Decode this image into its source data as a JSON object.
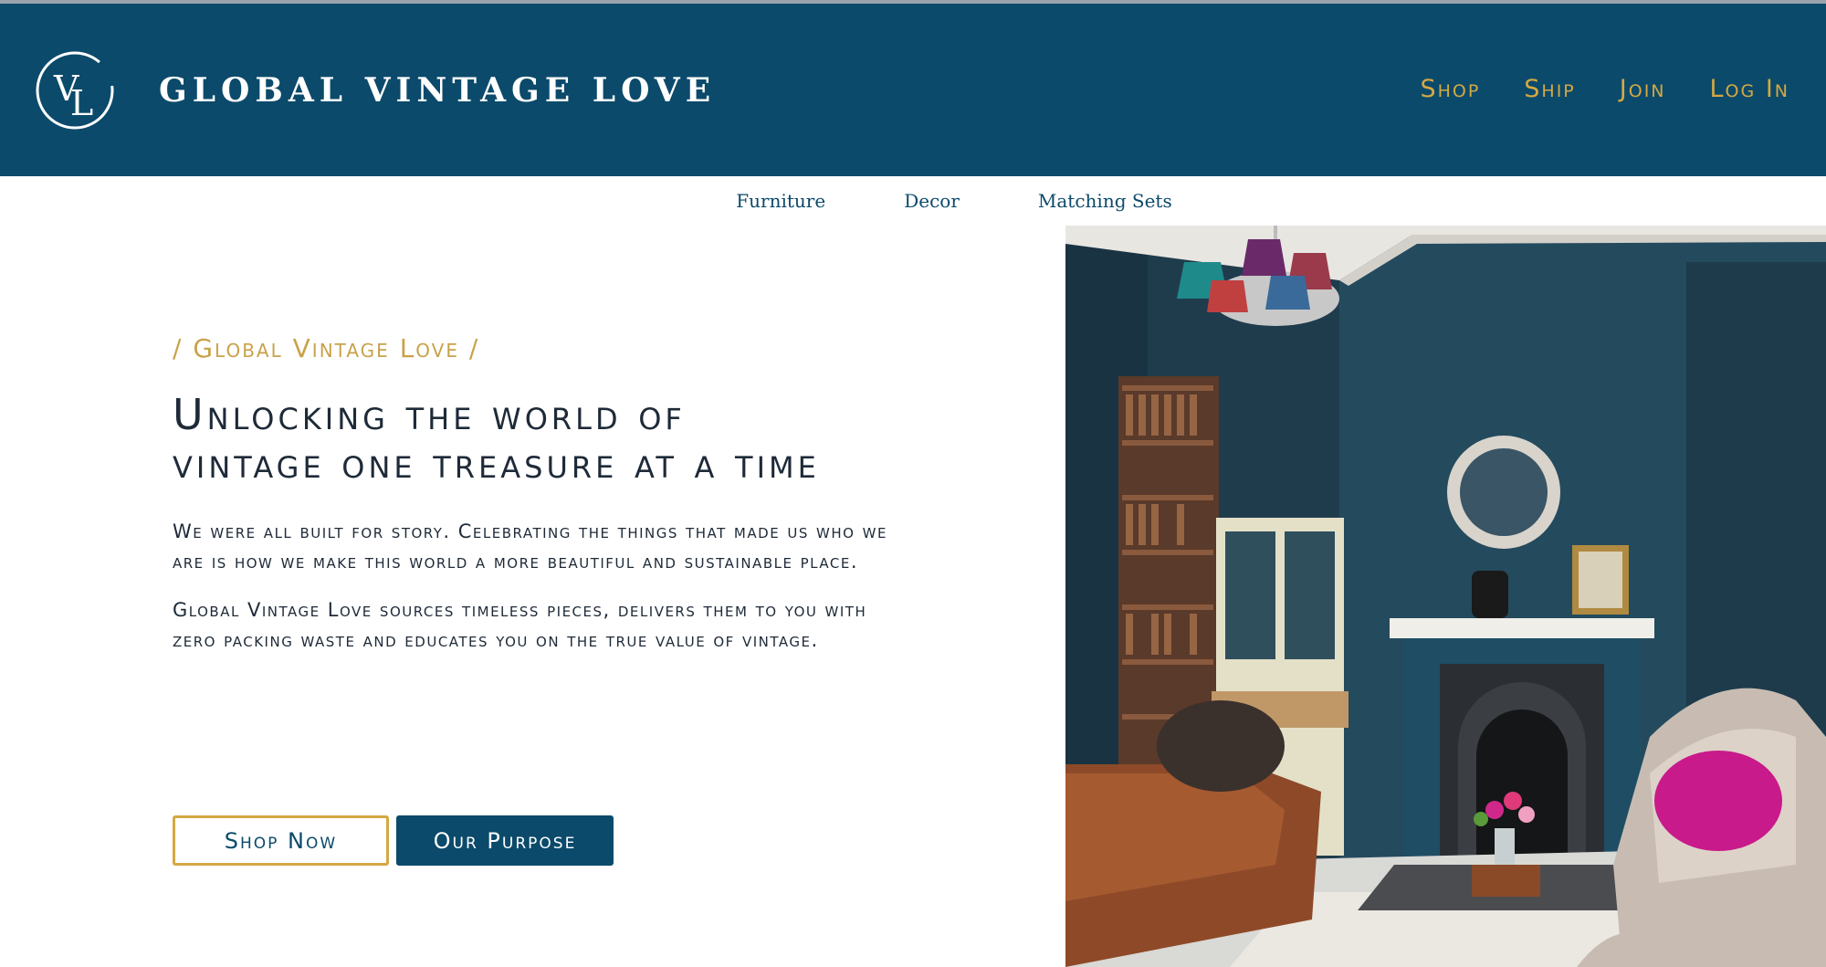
{
  "brand": {
    "logo_monogram": "VL",
    "name": "GLOBAL VINTAGE LOVE"
  },
  "topnav": {
    "items": [
      "Shop",
      "Ship",
      "Join",
      "Log In"
    ]
  },
  "subnav": {
    "items": [
      "Furniture",
      "Decor",
      "Matching Sets"
    ]
  },
  "hero": {
    "eyebrow": "/ Global Vintage Love /",
    "headline": "Unlocking the world of vintage one treasure at a time",
    "paragraph_1": "We were all built for story. Celebrating the things that made us who we are is how we make this world a more beautiful and sustainable place.",
    "paragraph_2": "Global Vintage Love sources timeless pieces, delivers them to you with zero packing waste and educates you on the true value of vintage.",
    "button_primary": "Shop Now",
    "button_secondary": "Our Purpose"
  },
  "colors": {
    "navy": "#0b4a6b",
    "gold": "#d4a843",
    "text": "#1e2a38"
  },
  "icons": {
    "logo": "vl-monogram-logo"
  }
}
